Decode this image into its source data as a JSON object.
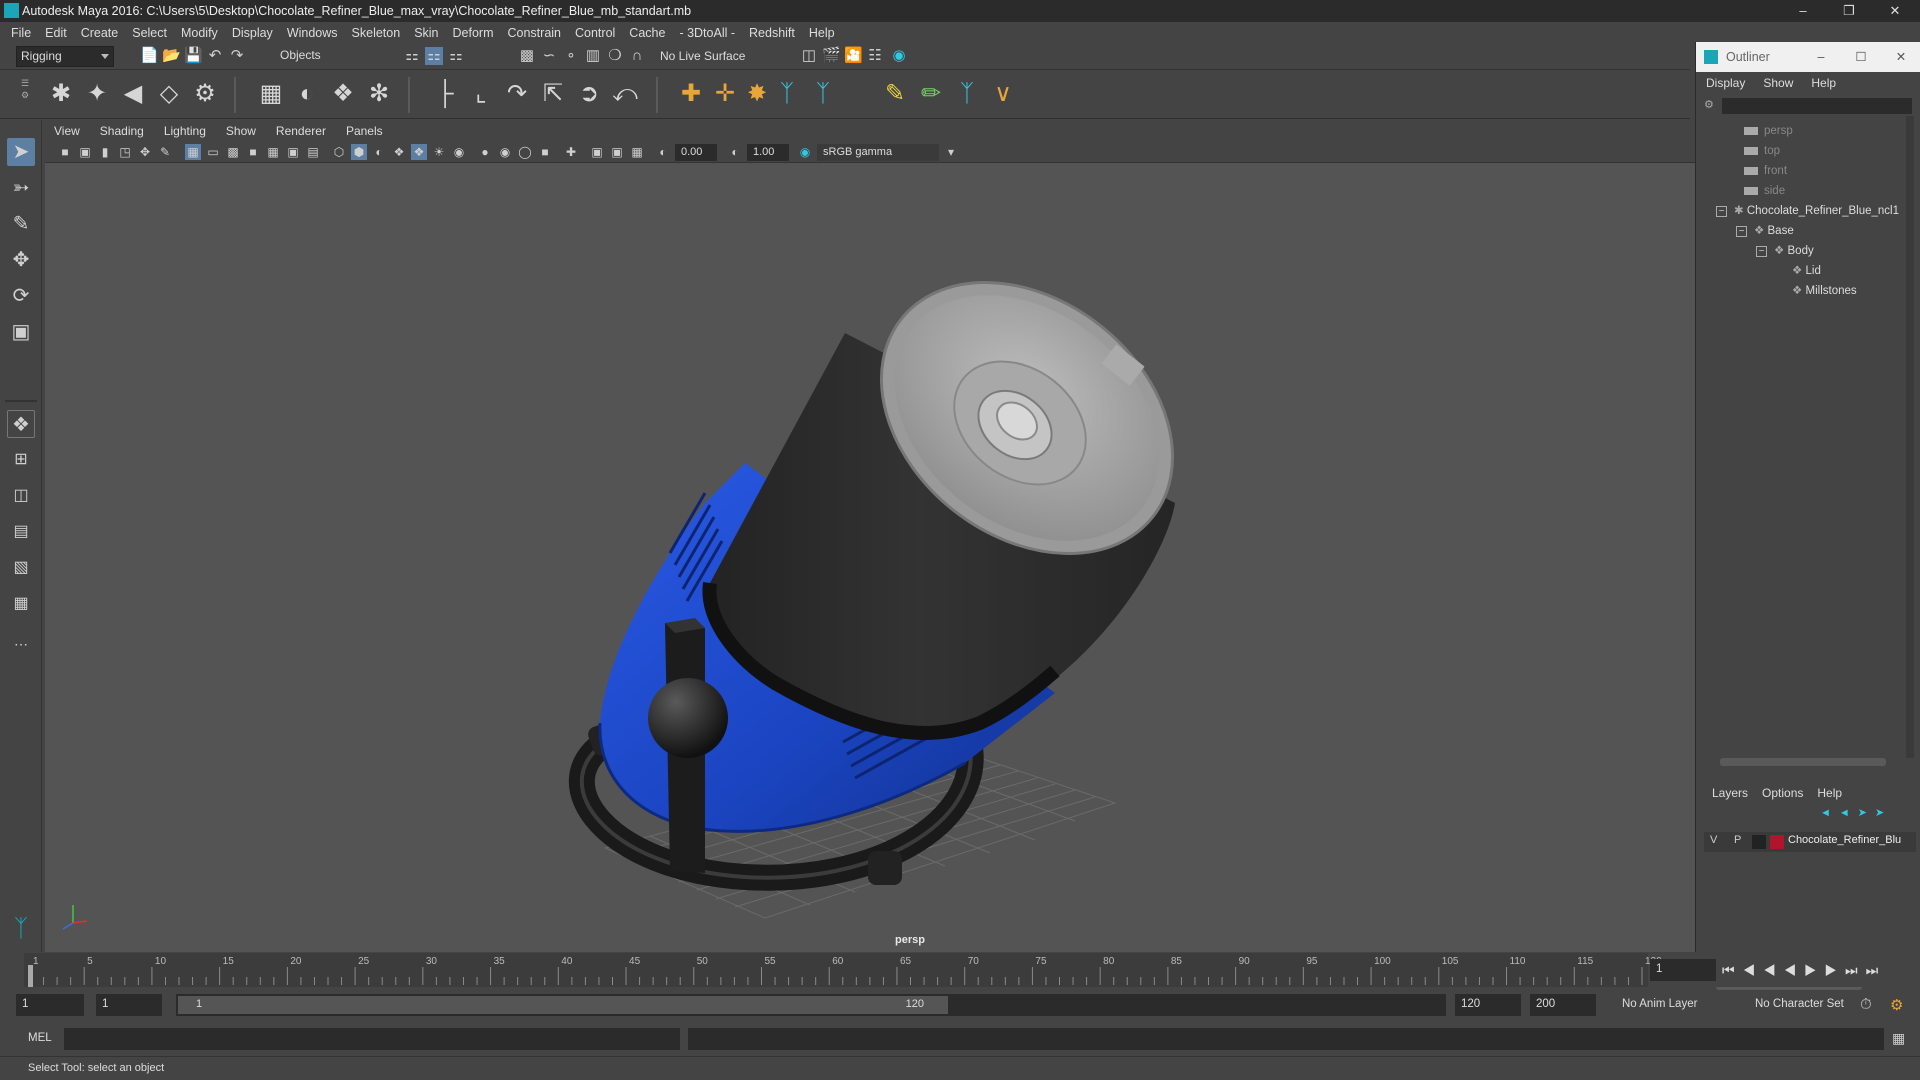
{
  "window": {
    "title": "Autodesk Maya 2016: C:\\Users\\5\\Desktop\\Chocolate_Refiner_Blue_max_vray\\Chocolate_Refiner_Blue_mb_standart.mb",
    "minimize": "–",
    "restore": "❐",
    "close": "✕"
  },
  "menubar": [
    "File",
    "Edit",
    "Create",
    "Select",
    "Modify",
    "Display",
    "Windows",
    "Skeleton",
    "Skin",
    "Deform",
    "Constrain",
    "Control",
    "Cache",
    "- 3DtoAll -",
    "Redshift",
    "Help"
  ],
  "statusline": {
    "mode": "Rigging",
    "select_mode": "Objects",
    "live_surface": "No Live Surface"
  },
  "viewport": {
    "menu": [
      "View",
      "Shading",
      "Lighting",
      "Show",
      "Renderer",
      "Panels"
    ],
    "exposure": "0.00",
    "gamma": "1.00",
    "color_space": "sRGB gamma",
    "camera_label": "persp",
    "colors": {
      "background": "#545454",
      "body": "#1a47c4",
      "barrel": "#2b2b2b",
      "lid": "#a6a6a6",
      "frame": "#1c1c1c"
    }
  },
  "timeline": {
    "ticks": [
      "1",
      "5",
      "10",
      "15",
      "20",
      "25",
      "30",
      "35",
      "40",
      "45",
      "50",
      "55",
      "60",
      "65",
      "70",
      "75",
      "80",
      "85",
      "90",
      "95",
      "100",
      "105",
      "110",
      "115",
      "120"
    ],
    "current_frame": "1"
  },
  "range": {
    "start": "1",
    "inner_start": "1",
    "slider_start": "1",
    "slider_end": "120",
    "end": "120",
    "max": "200",
    "anim_layer": "No Anim Layer",
    "character_set": "No Character Set"
  },
  "cmdline": {
    "label": "MEL"
  },
  "helpline": {
    "text": "Select Tool: select an object"
  },
  "outliner": {
    "title": "Outliner",
    "menu": [
      "Display",
      "Show",
      "Help"
    ],
    "cameras": [
      "persp",
      "top",
      "front",
      "side"
    ],
    "tree": [
      {
        "label": "Chocolate_Refiner_Blue_ncl1",
        "depth": 0
      },
      {
        "label": "Base",
        "depth": 1
      },
      {
        "label": "Body",
        "depth": 2
      },
      {
        "label": "Lid",
        "depth": 3
      },
      {
        "label": "Millstones",
        "depth": 3
      }
    ]
  },
  "layers": {
    "menu": [
      "Layers",
      "Options",
      "Help"
    ],
    "rows": [
      {
        "v": "V",
        "p": "P",
        "name": "Chocolate_Refiner_Blu",
        "color": "#b0152d"
      }
    ]
  }
}
